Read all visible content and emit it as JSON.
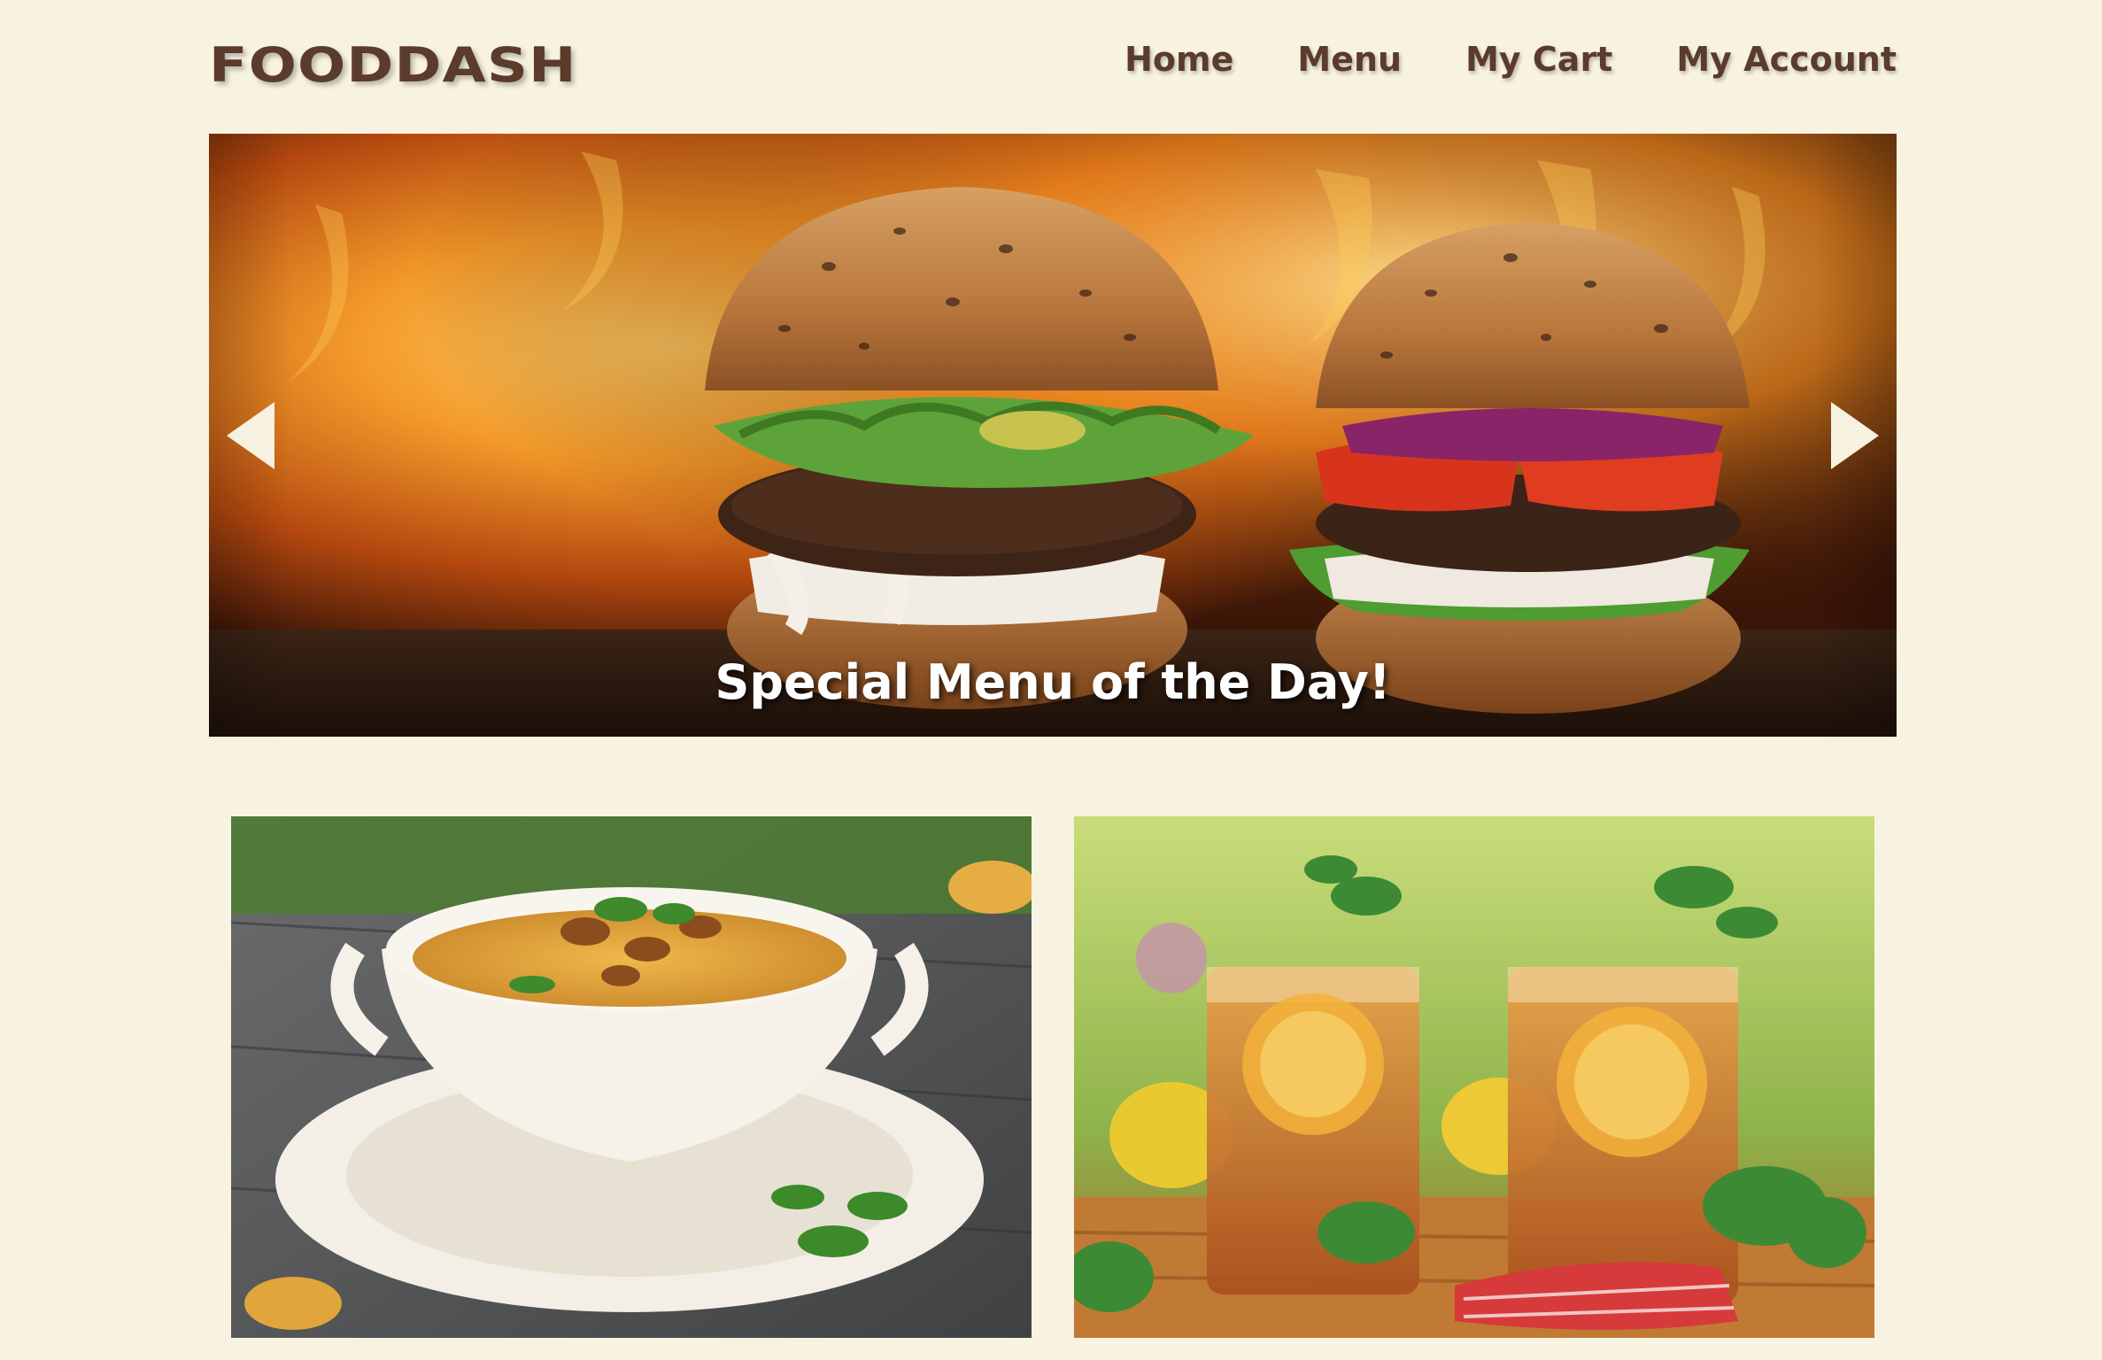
{
  "brand": {
    "logo_text": "FOODDASH"
  },
  "nav": {
    "items": [
      {
        "label": "Home"
      },
      {
        "label": "Menu"
      },
      {
        "label": "My Cart"
      },
      {
        "label": "My Account"
      }
    ]
  },
  "carousel": {
    "caption": "Special Menu of the Day!",
    "prev_icon": "triangle-left-icon",
    "next_icon": "triangle-right-icon"
  },
  "gallery": {
    "cards": [
      {
        "image_subject": "soup-bowl-with-mushrooms"
      },
      {
        "image_subject": "iced-tea-with-lemon-and-mint"
      }
    ]
  },
  "colors": {
    "background": "#f8f3e1",
    "brand_brown": "#5b3b2c",
    "caption_text": "#ffffff"
  }
}
